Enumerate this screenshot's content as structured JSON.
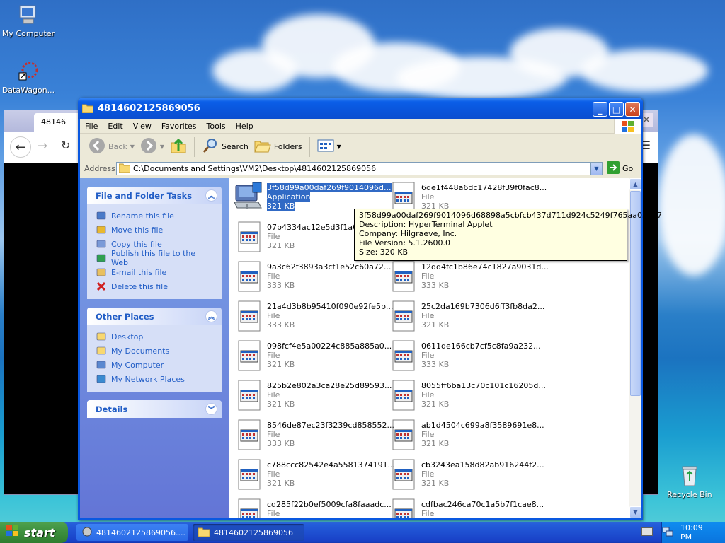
{
  "desktop": {
    "icons": [
      {
        "label": "My Computer",
        "icon": "my-computer-icon"
      },
      {
        "label": "DataWagon...",
        "icon": "datawagon-icon"
      },
      {
        "label": "Recycle Bin",
        "icon": "recycle-bin-icon"
      }
    ]
  },
  "browser": {
    "tab_title": "48146"
  },
  "window": {
    "title": "4814602125869056",
    "menu": [
      "File",
      "Edit",
      "View",
      "Favorites",
      "Tools",
      "Help"
    ],
    "toolbar": {
      "back": "Back",
      "search": "Search",
      "folders": "Folders"
    },
    "address": {
      "label": "Address",
      "value": "C:\\Documents and Settings\\VM2\\Desktop\\4814602125869056",
      "go": "Go"
    }
  },
  "tasks": {
    "file_tasks_title": "File and Folder Tasks",
    "file_tasks": [
      {
        "label": "Rename this file",
        "icon": "rename-icon"
      },
      {
        "label": "Move this file",
        "icon": "move-icon"
      },
      {
        "label": "Copy this file",
        "icon": "copy-icon"
      },
      {
        "label": "Publish this file to the Web",
        "icon": "publish-web-icon"
      },
      {
        "label": "E-mail this file",
        "icon": "email-icon"
      },
      {
        "label": "Delete this file",
        "icon": "delete-icon"
      }
    ],
    "other_places_title": "Other Places",
    "other_places": [
      {
        "label": "Desktop",
        "icon": "desktop-folder-icon"
      },
      {
        "label": "My Documents",
        "icon": "my-documents-icon"
      },
      {
        "label": "My Computer",
        "icon": "my-computer-icon"
      },
      {
        "label": "My Network Places",
        "icon": "network-places-icon"
      }
    ],
    "details_title": "Details"
  },
  "files": [
    {
      "name": "3f58d99a00daf269f9014096d...",
      "type": "Application",
      "size": "321 KB",
      "selected": true,
      "kind": "app"
    },
    {
      "name": "6de1f448a6dc17428f39f0fac8...",
      "type": "File",
      "size": "321 KB",
      "kind": "file"
    },
    {
      "name": "07b4334ac12e5d3f1a0e8",
      "type": "File",
      "size": "321 KB",
      "kind": "file"
    },
    {
      "name": "",
      "type": "",
      "size": "",
      "kind": "hidden"
    },
    {
      "name": "9a3c62f3893a3cf1e52c60a72...",
      "type": "File",
      "size": "333 KB",
      "kind": "file"
    },
    {
      "name": "12dd4fc1b86e74c1827a9031d...",
      "type": "File",
      "size": "333 KB",
      "kind": "file"
    },
    {
      "name": "21a4d3b8b95410f090e92fe5b...",
      "type": "File",
      "size": "333 KB",
      "kind": "file"
    },
    {
      "name": "25c2da169b7306d6ff3fb8da2...",
      "type": "File",
      "size": "321 KB",
      "kind": "file"
    },
    {
      "name": "098fcf4e5a00224c885a885a0...",
      "type": "File",
      "size": "321 KB",
      "kind": "file"
    },
    {
      "name": "0611de166cb7cf5c8fa9a232...",
      "type": "File",
      "size": "333 KB",
      "kind": "file"
    },
    {
      "name": "825b2e802a3ca28e25d89593...",
      "type": "File",
      "size": "321 KB",
      "kind": "file"
    },
    {
      "name": "8055ff6ba13c70c101c16205d...",
      "type": "File",
      "size": "321 KB",
      "kind": "file"
    },
    {
      "name": "8546de87ec23f3239cd858552...",
      "type": "File",
      "size": "333 KB",
      "kind": "file"
    },
    {
      "name": "ab1d4504c699a8f3589691e8...",
      "type": "File",
      "size": "321 KB",
      "kind": "file"
    },
    {
      "name": "c788ccc82542e4a5581374191...",
      "type": "File",
      "size": "321 KB",
      "kind": "file"
    },
    {
      "name": "cb3243ea158d82ab916244f2...",
      "type": "File",
      "size": "321 KB",
      "kind": "file"
    },
    {
      "name": "cd285f22b0ef5009cfa8faaadc...",
      "type": "File",
      "size": "",
      "kind": "file"
    },
    {
      "name": "cdfbac246ca70c1a5b7f1cae8...",
      "type": "File",
      "size": "",
      "kind": "file"
    }
  ],
  "tooltip": {
    "line1": "3f58d99a00daf269f9014096d68898a5cbfcb437d711d924c5249f765aa032b7",
    "line2": "Description: HyperTerminal Applet",
    "line3": "Company: Hilgraeve, Inc.",
    "line4": "File Version: 5.1.2600.0",
    "line5": "Size: 320 KB"
  },
  "taskbar": {
    "start": "start",
    "buttons": [
      "4814602125869056....",
      "4814602125869056"
    ],
    "clock": "10:09 PM"
  },
  "colors": {
    "accent": "#0a58e0",
    "selection": "#316ac5",
    "taskpane_link": "#215dc6"
  }
}
